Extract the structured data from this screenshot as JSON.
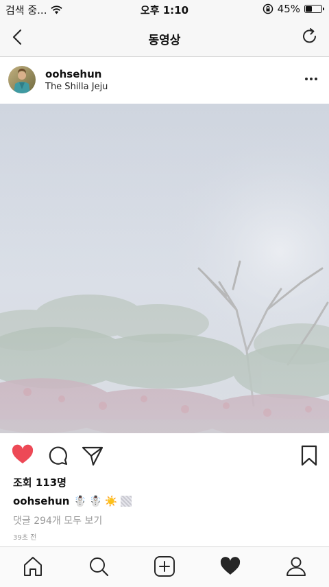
{
  "status": {
    "carrier": "검색 중...",
    "time": "오후 1:10",
    "battery_percent": "45%",
    "battery_level": 0.45
  },
  "nav": {
    "title": "동영상"
  },
  "post": {
    "username": "oohsehun",
    "location": "The Shilla Jeju"
  },
  "meta": {
    "views": "조회 113명",
    "caption_user": "oohsehun",
    "caption_emojis": [
      "☃️",
      "☃️",
      "☀️"
    ],
    "comments_link": "댓글 294개 모두 보기",
    "timestamp": "39초 전"
  },
  "colors": {
    "like": "#ed4956",
    "icon": "#262626"
  },
  "icons": {
    "nav": [
      "back-arrow-icon",
      "refresh-icon"
    ],
    "actions": [
      "heart-icon",
      "comment-icon",
      "share-icon",
      "bookmark-icon"
    ],
    "tabs": [
      "home-icon",
      "search-icon",
      "add-post-icon",
      "activity-heart-icon",
      "profile-icon"
    ]
  }
}
